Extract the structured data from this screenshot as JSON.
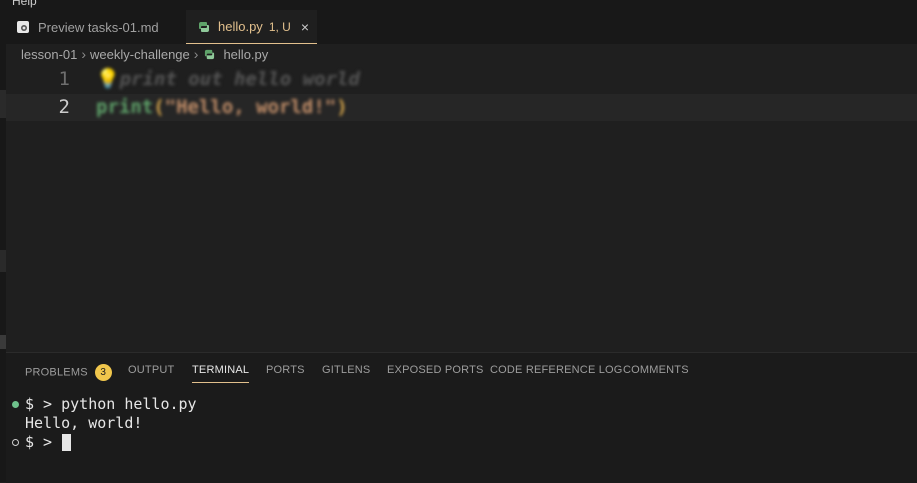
{
  "menu": {
    "help_label": "Help"
  },
  "tabs": [
    {
      "label": "Preview tasks-01.md",
      "icon": "preview-icon"
    },
    {
      "label": "hello.py",
      "status": "1, U",
      "icon": "python-icon",
      "close": "×"
    }
  ],
  "breadcrumb": {
    "items": [
      "lesson-01",
      "weekly-challenge",
      "hello.py"
    ],
    "separator": "›"
  },
  "editor": {
    "lines": [
      {
        "number": "1",
        "tokens": {
          "bulb": "💡",
          "comment": "print out hello world"
        }
      },
      {
        "number": "2",
        "tokens": {
          "fn": "print",
          "open": "(",
          "string": "\"Hello, world!\"",
          "close": ")"
        }
      }
    ]
  },
  "panel": {
    "tabs": [
      {
        "label": "PROBLEMS",
        "badge": "3"
      },
      {
        "label": "OUTPUT"
      },
      {
        "label": "TERMINAL",
        "active": true
      },
      {
        "label": "PORTS"
      },
      {
        "label": "GITLENS"
      },
      {
        "label": "EXPOSED PORTS"
      },
      {
        "label": "CODE REFERENCE LOG"
      },
      {
        "label": "COMMENTS"
      }
    ]
  },
  "terminal": {
    "lines": [
      {
        "prompt": "$ > ",
        "command": "python hello.py"
      },
      {
        "output": "Hello, world!"
      },
      {
        "prompt": "$ > ",
        "command": ""
      }
    ]
  },
  "colors": {
    "accent": "#e2c08d",
    "badge": "#f0c64c",
    "success_dot": "#6ec18b"
  }
}
